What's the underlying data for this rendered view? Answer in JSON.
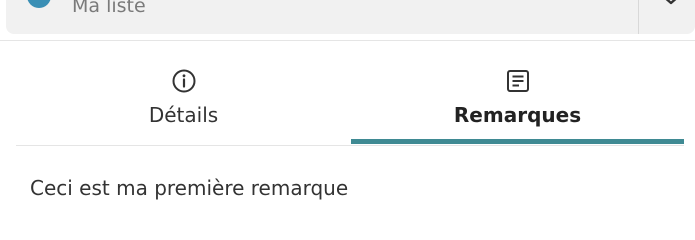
{
  "list_select": {
    "value": "Ma liste",
    "dot_color": "#3a8fb5"
  },
  "tabs": [
    {
      "label": "Détails",
      "icon": "info-icon",
      "active": false
    },
    {
      "label": "Remarques",
      "icon": "document-icon",
      "active": true
    }
  ],
  "active_tab_color": "#3f8a93",
  "remarks": {
    "items": [
      "Ceci est ma première remarque"
    ]
  }
}
